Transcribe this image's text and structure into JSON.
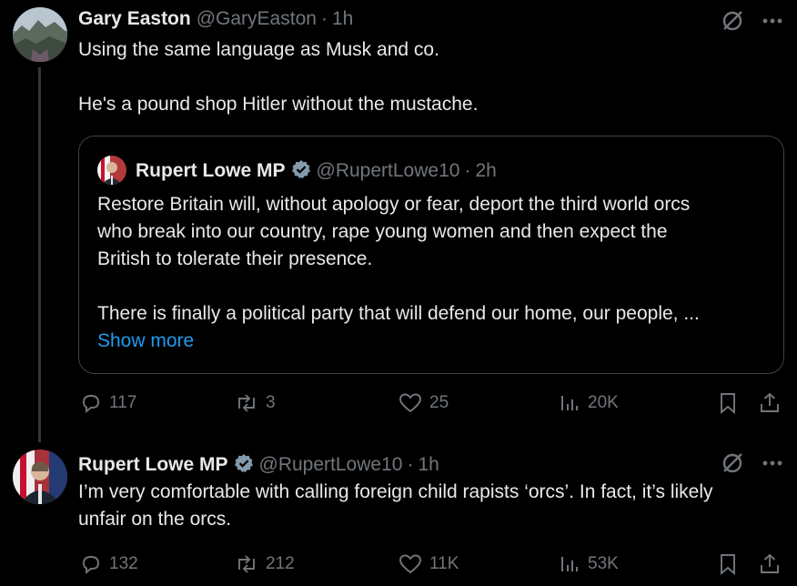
{
  "tweets": [
    {
      "author": "Gary Easton",
      "handle": "@GaryEaston",
      "dot": "·",
      "time": "1h",
      "lines": [
        "Using the same language as Musk and co.",
        "He's a pound shop Hitler without the mustache."
      ],
      "quote": {
        "author": "Rupert Lowe MP",
        "handle": "@RupertLowe10",
        "dot": "·",
        "time": "2h",
        "lines": [
          "Restore Britain will, without apology or fear, deport the third world orcs",
          "who break into our country, rape young women and then expect the",
          "British to tolerate their presence.",
          "There is finally a political party that will defend our home, our people, ..."
        ],
        "show_more": "Show more"
      },
      "stats": {
        "replies": "117",
        "reposts": "3",
        "likes": "25",
        "views": "20K"
      }
    },
    {
      "author": "Rupert Lowe MP",
      "handle": "@RupertLowe10",
      "dot": "·",
      "time": "1h",
      "lines": [
        "I’m very comfortable with calling foreign child rapists ‘orcs’. In fact, it’s likely",
        "unfair on the orcs."
      ],
      "stats": {
        "replies": "132",
        "reposts": "212",
        "likes": "11K",
        "views": "53K"
      }
    }
  ],
  "colors": {
    "background": "#000000",
    "text": "#e7e9ea",
    "muted": "#71767b",
    "link": "#1d9bf0",
    "border": "#3e4144",
    "verified": "#829aab"
  },
  "icons": [
    "grok-icon",
    "more-icon",
    "verified-badge-icon",
    "reply-icon",
    "repost-icon",
    "like-icon",
    "views-icon",
    "bookmark-icon",
    "share-icon"
  ]
}
